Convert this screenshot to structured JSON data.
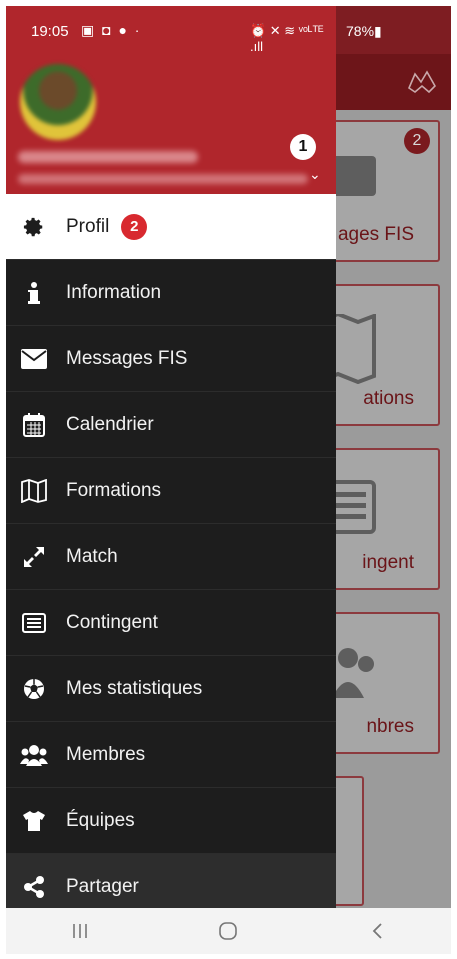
{
  "status_bar": {
    "time": "19:05",
    "left_icons": "▣ ◘ ● ·",
    "right_icons": "⏰ ✕ ≋ ᵛᵒᴸᵀᴱ .ıll",
    "battery": "78%▮"
  },
  "drawer": {
    "callout_1": "1",
    "items": [
      {
        "label": "Profil",
        "icon": "gear-icon",
        "callout": "2"
      },
      {
        "label": "Information",
        "icon": "info-icon"
      },
      {
        "label": "Messages FIS",
        "icon": "envelope-icon"
      },
      {
        "label": "Calendrier",
        "icon": "calendar-icon"
      },
      {
        "label": "Formations",
        "icon": "map-icon"
      },
      {
        "label": "Match",
        "icon": "expand-arrows-icon"
      },
      {
        "label": "Contingent",
        "icon": "list-card-icon"
      },
      {
        "label": "Mes statistiques",
        "icon": "soccer-ball-icon"
      },
      {
        "label": "Membres",
        "icon": "users-icon"
      },
      {
        "label": "Équipes",
        "icon": "shirt-icon"
      },
      {
        "label": "Partager",
        "icon": "share-icon"
      }
    ]
  },
  "background": {
    "tiles": [
      {
        "label": "ages FIS",
        "badge": "2"
      },
      {
        "label": "ations"
      },
      {
        "label": "ingent"
      },
      {
        "label": "nbres"
      }
    ]
  },
  "colors": {
    "brand_red": "#b0262c",
    "drawer_bg": "#1d1d1d",
    "callout_red": "#d8292f"
  }
}
